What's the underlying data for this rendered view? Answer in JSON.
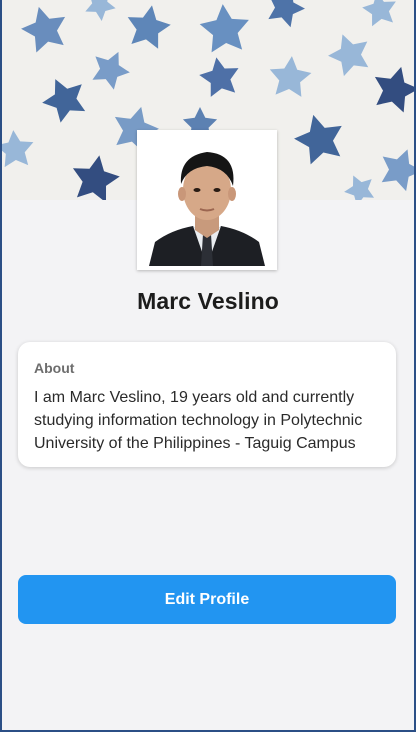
{
  "profile": {
    "name": "Marc Veslino",
    "avatar_icon": "profile-photo",
    "cover_icon": "watercolor-stars-pattern"
  },
  "about": {
    "title": "About",
    "text": "I am Marc Veslino, 19 years old and currently studying information technology in Polytechnic University of the Philippines - Taguig Campus"
  },
  "actions": {
    "edit_label": "Edit Profile"
  },
  "colors": {
    "accent": "#2295f1",
    "background": "#f3f3f5",
    "star_dark": "#1f3c75",
    "star_mid": "#4c76ac",
    "star_light": "#8fb1d6"
  }
}
